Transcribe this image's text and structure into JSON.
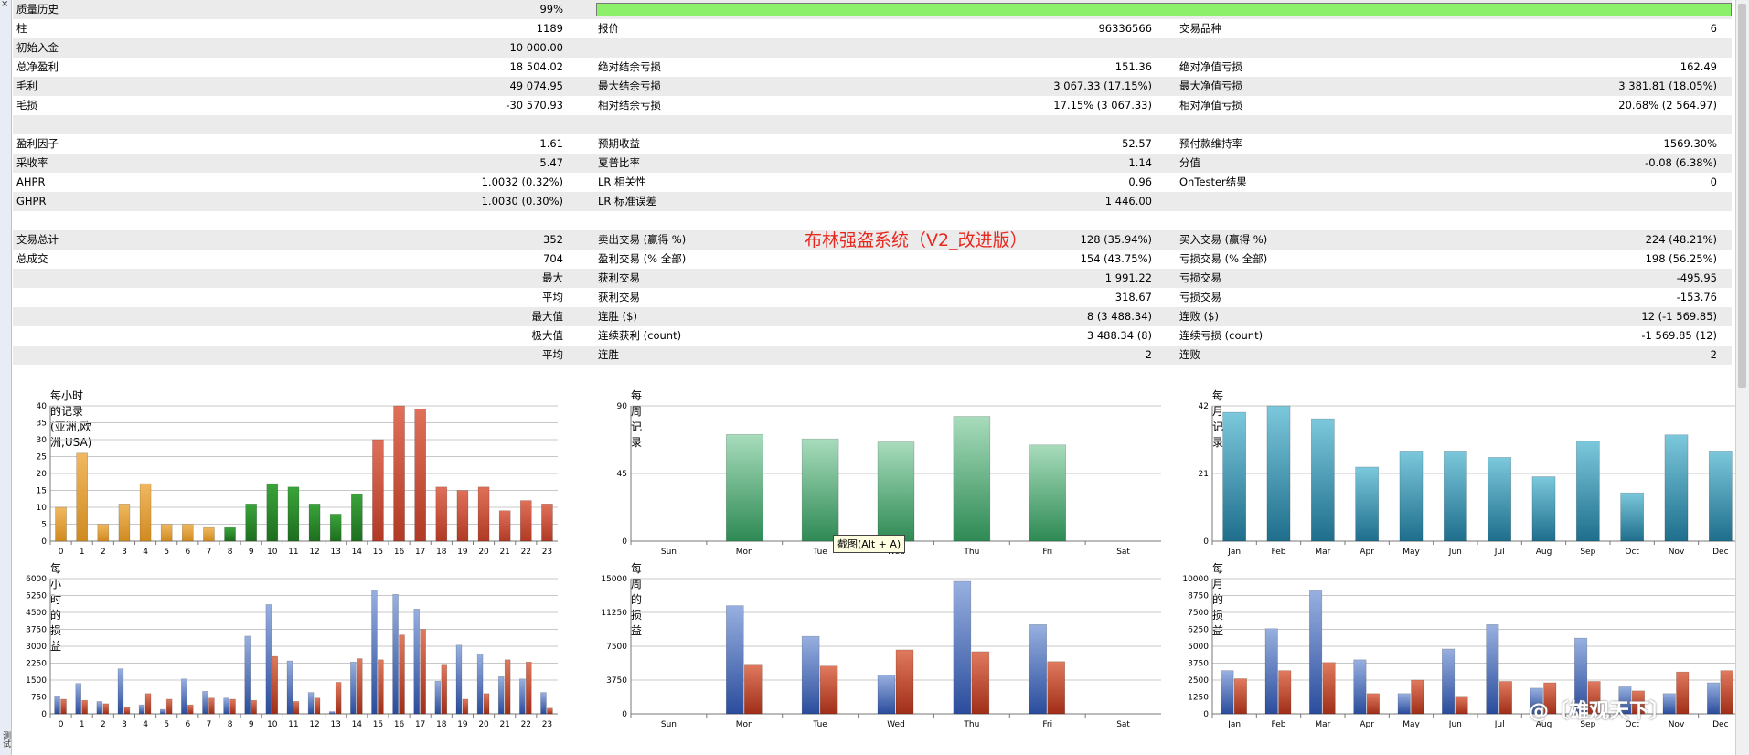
{
  "colors": {
    "quality_bar": "#8cf06a",
    "orange": "#e6a030",
    "green": "#2a8a2a",
    "red": "#c84a34",
    "week_green": "#3c9a5e",
    "month_cyan": "#2a8eaa",
    "blue": "#3a62b4",
    "loss_red": "#b4402a",
    "title_red": "#e8281e"
  },
  "overlay_title": "布林强盗系统（V2_改进版）",
  "tooltip": "截图(Alt + A)",
  "watermark": "@〔雄观天下〕",
  "left_tab_label": "测试",
  "rows": [
    {
      "c1": "质量历史",
      "v1": "99%",
      "c2": "",
      "v2": "",
      "c3": "",
      "v3": "",
      "bar": true
    },
    {
      "c1": "柱",
      "v1": "1189",
      "c2": "报价",
      "v2": "96336566",
      "c3": "交易品种",
      "v3": "6"
    },
    {
      "c1": "初始入金",
      "v1": "10 000.00",
      "c2": "",
      "v2": "",
      "c3": "",
      "v3": ""
    },
    {
      "c1": "总净盈利",
      "v1": "18 504.02",
      "c2": "绝对结余亏损",
      "v2": "151.36",
      "c3": "绝对净值亏损",
      "v3": "162.49"
    },
    {
      "c1": "毛利",
      "v1": "49 074.95",
      "c2": "最大结余亏损",
      "v2": "3 067.33 (17.15%)",
      "c3": "最大净值亏损",
      "v3": "3 381.81 (18.05%)"
    },
    {
      "c1": "毛损",
      "v1": "-30 570.93",
      "c2": "相对结余亏损",
      "v2": "17.15% (3 067.33)",
      "c3": "相对净值亏损",
      "v3": "20.68% (2 564.97)"
    },
    {
      "c1": "",
      "v1": "",
      "c2": "",
      "v2": "",
      "c3": "",
      "v3": ""
    },
    {
      "c1": "盈利因子",
      "v1": "1.61",
      "c2": "预期收益",
      "v2": "52.57",
      "c3": "预付款维持率",
      "v3": "1569.30%"
    },
    {
      "c1": "采收率",
      "v1": "5.47",
      "c2": "夏普比率",
      "v2": "1.14",
      "c3": "分值",
      "v3": "-0.08 (6.38%)"
    },
    {
      "c1": "AHPR",
      "v1": "1.0032 (0.32%)",
      "c2": "LR 相关性",
      "v2": "0.96",
      "c3": "OnTester结果",
      "v3": "0"
    },
    {
      "c1": "GHPR",
      "v1": "1.0030 (0.30%)",
      "c2": "LR 标准误差",
      "v2": "1 446.00",
      "c3": "",
      "v3": ""
    },
    {
      "c1": "",
      "v1": "",
      "c2": "",
      "v2": "",
      "c3": "",
      "v3": ""
    },
    {
      "c1": "交易总计",
      "v1": "352",
      "c2": "卖出交易 (赢得 %)",
      "v2": "128 (35.94%)",
      "c3": "买入交易 (赢得 %)",
      "v3": "224 (48.21%)"
    },
    {
      "c1": "总成交",
      "v1": "704",
      "c2": "盈利交易 (% 全部)",
      "v2": "154 (43.75%)",
      "c3": "亏损交易 (% 全部)",
      "v3": "198 (56.25%)"
    },
    {
      "c1": "",
      "v1": "最大",
      "c2": "获利交易",
      "v2": "1 991.22",
      "c3": "亏损交易",
      "v3": "-495.95"
    },
    {
      "c1": "",
      "v1": "平均",
      "c2": "获利交易",
      "v2": "318.67",
      "c3": "亏损交易",
      "v3": "-153.76"
    },
    {
      "c1": "",
      "v1": "最大值",
      "c2": "连胜 ($)",
      "v2": "8 (3 488.34)",
      "c3": "连败 ($)",
      "v3": "12 (-1 569.85)"
    },
    {
      "c1": "",
      "v1": "极大值",
      "c2": "连续获利 (count)",
      "v2": "3 488.34 (8)",
      "c3": "连续亏损 (count)",
      "v3": "-1 569.85 (12)"
    },
    {
      "c1": "",
      "v1": "平均",
      "c2": "连胜",
      "v2": "2",
      "c3": "连败",
      "v3": "2"
    },
    {
      "c1": "",
      "v1": "",
      "c2": "",
      "v2": "",
      "c3": "",
      "v3": ""
    }
  ],
  "chart_data": [
    {
      "type": "bar",
      "title": "每小时的记录(亚洲,欧洲,USA)",
      "categories": [
        "0",
        "1",
        "2",
        "3",
        "4",
        "5",
        "6",
        "7",
        "8",
        "9",
        "10",
        "11",
        "12",
        "13",
        "14",
        "15",
        "16",
        "17",
        "18",
        "19",
        "20",
        "21",
        "22",
        "23"
      ],
      "values": [
        10,
        26,
        5,
        11,
        17,
        5,
        5,
        4,
        4,
        11,
        17,
        16,
        11,
        8,
        14,
        30,
        40,
        39,
        16,
        15,
        16,
        9,
        12,
        11
      ],
      "yticks": [
        "0",
        "5",
        "10",
        "15",
        "20",
        "25",
        "30",
        "35",
        "40"
      ],
      "ylim": [
        0,
        40
      ]
    },
    {
      "type": "bar",
      "title": "每周记录",
      "categories": [
        "Sun",
        "Mon",
        "Tue",
        "Wed",
        "Thu",
        "Fri",
        "Sat"
      ],
      "values": [
        0,
        71,
        68,
        66,
        83,
        64,
        0
      ],
      "yticks": [
        "0",
        "45",
        "90"
      ],
      "ylim": [
        0,
        90
      ]
    },
    {
      "type": "bar",
      "title": "每月记录",
      "categories": [
        "Jan",
        "Feb",
        "Mar",
        "Apr",
        "May",
        "Jun",
        "Jul",
        "Aug",
        "Sep",
        "Oct",
        "Nov",
        "Dec"
      ],
      "values": [
        40,
        42,
        38,
        23,
        28,
        28,
        26,
        20,
        31,
        15,
        33,
        28
      ],
      "yticks": [
        "0",
        "21",
        "42"
      ],
      "ylim": [
        0,
        42
      ]
    },
    {
      "type": "bar",
      "title": "每小时的损益",
      "categories": [
        "0",
        "1",
        "2",
        "3",
        "4",
        "5",
        "6",
        "7",
        "8",
        "9",
        "10",
        "11",
        "12",
        "13",
        "14",
        "15",
        "16",
        "17",
        "18",
        "19",
        "20",
        "21",
        "22",
        "23"
      ],
      "series": [
        {
          "values": [
            800,
            1350,
            550,
            2000,
            400,
            200,
            1550,
            1000,
            700,
            3450,
            4850,
            2350,
            950,
            100,
            2300,
            5500,
            5300,
            4650,
            1450,
            3050,
            2650,
            1650,
            1550,
            950
          ]
        },
        {
          "values": [
            650,
            600,
            450,
            300,
            900,
            650,
            400,
            700,
            650,
            600,
            2550,
            550,
            700,
            1400,
            2450,
            2400,
            3500,
            3750,
            2200,
            650,
            900,
            2400,
            2300,
            250
          ]
        }
      ],
      "yticks": [
        "0",
        "750",
        "1500",
        "2250",
        "3000",
        "3750",
        "4500",
        "5250",
        "6000"
      ],
      "ylim": [
        0,
        6000
      ]
    },
    {
      "type": "bar",
      "title": "每周的损益",
      "categories": [
        "Sun",
        "Mon",
        "Tue",
        "Wed",
        "Thu",
        "Fri",
        "Sat"
      ],
      "series": [
        {
          "values": [
            0,
            12000,
            8600,
            4300,
            14700,
            9900,
            0
          ]
        },
        {
          "values": [
            0,
            5500,
            5300,
            7100,
            6900,
            5800,
            0
          ]
        }
      ],
      "yticks": [
        "0",
        "3750",
        "7500",
        "11250",
        "15000"
      ],
      "ylim": [
        0,
        15000
      ]
    },
    {
      "type": "bar",
      "title": "每月的损益",
      "categories": [
        "Jan",
        "Feb",
        "Mar",
        "Apr",
        "May",
        "Jun",
        "Jul",
        "Aug",
        "Sep",
        "Oct",
        "Nov",
        "Dec"
      ],
      "series": [
        {
          "values": [
            3200,
            6300,
            9100,
            4000,
            1500,
            4800,
            6600,
            1900,
            5600,
            2000,
            1500,
            2300
          ]
        },
        {
          "values": [
            2600,
            3200,
            3800,
            1500,
            2500,
            1300,
            2400,
            2300,
            2400,
            1700,
            3100,
            3200
          ]
        }
      ],
      "yticks": [
        "0",
        "1250",
        "2500",
        "3750",
        "5000",
        "6250",
        "7500",
        "8750",
        "10000"
      ],
      "ylim": [
        0,
        10000
      ]
    }
  ]
}
